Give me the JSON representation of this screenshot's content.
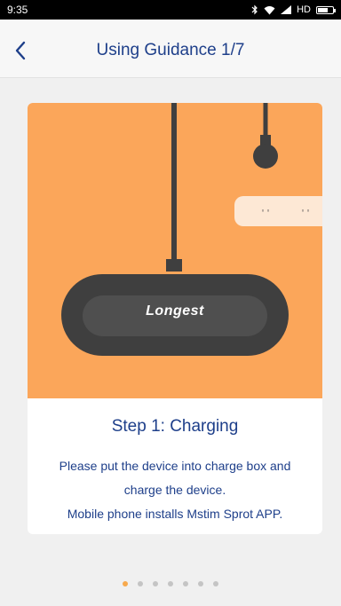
{
  "status_bar": {
    "time": "9:35",
    "network_label": "HD",
    "icons": [
      "bluetooth-icon",
      "wifi-icon",
      "signal-icon",
      "battery-icon"
    ]
  },
  "header": {
    "title": "Using Guidance 1/7",
    "back_icon": "chevron-left-icon"
  },
  "guide": {
    "device_brand": "Longest",
    "step_title": "Step 1: Charging",
    "description_lines": [
      "Please put the device into charge box and",
      "charge the device.",
      "Mobile phone installs Mstim Sprot APP."
    ]
  },
  "pager": {
    "total": 7,
    "active_index": 0
  },
  "colors": {
    "accent_text": "#1e3f8a",
    "illustration_bg": "#fba65a",
    "active_dot": "#f7a94d",
    "inactive_dot": "#c4c4c4"
  }
}
